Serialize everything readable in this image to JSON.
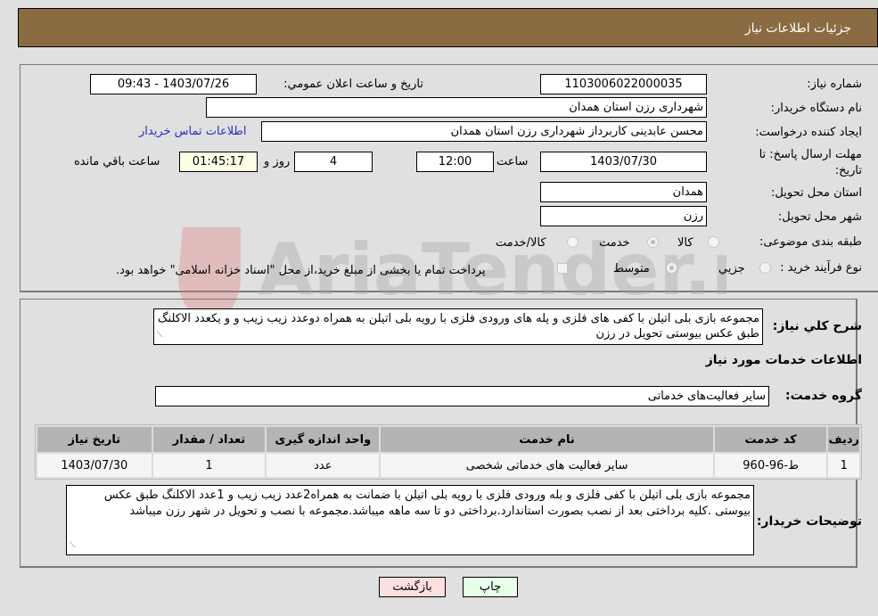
{
  "header": {
    "title": "جزئیات اطلاعات نیاز"
  },
  "details": {
    "need_number_label": "شماره نیاز:",
    "need_number": "1103006022000035",
    "announce_label": "تاریخ و ساعت اعلان عمومي:",
    "announce_value": "1403/07/26 - 09:43",
    "buyer_org_label": "نام دستگاه خریدار:",
    "buyer_org": "شهرداری رزن استان همدان",
    "creator_label": "ایجاد کننده درخواست:",
    "creator": "محسن عابدینی کاربرداز شهرداری رزن استان همدان",
    "contact_link": "اطلاعات تماس خریدار",
    "deadline_label_1": "مهلت ارسال پاسخ: تا",
    "deadline_label_2": "تاریخ:",
    "deadline_date": "1403/07/30",
    "time_label": "ساعت",
    "deadline_time": "12:00",
    "days_value": "4",
    "days_label": "روز و",
    "remaining_time": "01:45:17",
    "remaining_label": "ساعت باقي مانده",
    "province_label": "استان محل تحویل:",
    "province": "همدان",
    "city_label": "شهر محل تحویل:",
    "city": "رزن",
    "category_label": "طبقه بندی موضوعی:",
    "category_options": [
      {
        "label": "کالا",
        "selected": false
      },
      {
        "label": "خدمت",
        "selected": true
      },
      {
        "label": "کالا/خدمت",
        "selected": false
      }
    ],
    "process_label": "نوع فرآیند خرید :",
    "process_options": [
      {
        "label": "جزيي",
        "selected": false
      },
      {
        "label": "متوسط",
        "selected": true
      }
    ],
    "treasury_text": "پرداخت تمام یا بخشی از مبلغ خرید،از محل \"اسناد خزانه اسلامی\" خواهد بود.",
    "treasury_checked": false
  },
  "summary": {
    "label": "شرح کلي نیاز:",
    "text": "مجموعه بازی بلی اتیلن با کفی های فلزی و پله های ورودی فلزی با رویه بلی اتیلن به همراه دوعدد زیب زیب و و یکعدد الاکلنگ طبق عکس بیوستی تحویل در رزن"
  },
  "services": {
    "section_title": "اطلاعات خدمات مورد نیاز",
    "group_label": "گروه خدمت:",
    "group_value": "سایر فعالیت‌های خدماتی",
    "columns": [
      "ردیف",
      "کد خدمت",
      "نام خدمت",
      "واحد اندازه گیری",
      "تعداد / مقدار",
      "تاریخ نیاز"
    ],
    "rows": [
      [
        "1",
        "ط-96-960",
        "سایر فعالیت های خدماتی شخصی",
        "عدد",
        "1",
        "1403/07/30"
      ]
    ]
  },
  "buyer_notes": {
    "label": "توضیحات خریدار:",
    "text": "مجموعه بازی بلی اتیلن با کفی فلزی و بله ورودی فلزی با رویه بلی اتیلن با ضمانت به همراه2عدد زیب زیب و 1عدد الاکلنگ طبق عکس بیوستی .کلیه برداختی بعد از نصب بصورت استاندارد.برداختی دو تا سه ماهه میباشد.مجموعه با نصب و تحویل در شهر رزن میباشد"
  },
  "buttons": {
    "print": "چاپ",
    "back": "بازگشت"
  },
  "watermark": {
    "text": "AriaTender.neT"
  }
}
